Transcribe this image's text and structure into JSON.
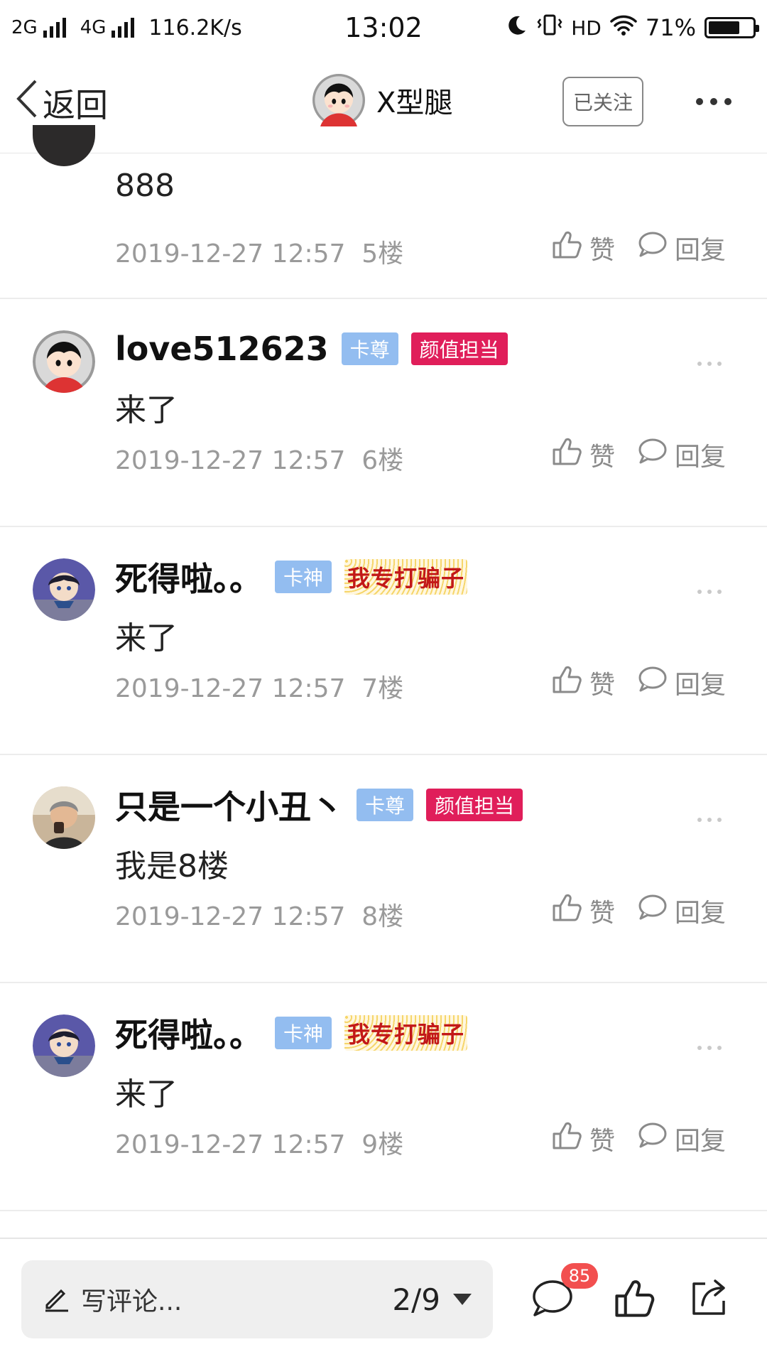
{
  "status_bar": {
    "net1": "2G",
    "net2": "4G",
    "speed": "116.2K/s",
    "time": "13:02",
    "hd": "HD",
    "battery": "71%",
    "battery_level": 0.71
  },
  "nav": {
    "back_label": "返回",
    "title": "X型腿",
    "follow_label": "已关注"
  },
  "partial_comment": {
    "content": "888",
    "time": "2019-12-27 12:57",
    "floor": "5楼",
    "like_label": "赞",
    "reply_label": "回复"
  },
  "comments": [
    {
      "username": "love512623",
      "tags": [
        "卡尊",
        "颜值担当"
      ],
      "content": "来了",
      "time": "2019-12-27 12:57",
      "floor": "6楼",
      "like_label": "赞",
      "reply_label": "回复",
      "avatar": "cartoon-boy"
    },
    {
      "username": "死得啦。。",
      "tags": [
        "卡神",
        "我专打骗子"
      ],
      "content": "来了",
      "time": "2019-12-27 12:57",
      "floor": "7楼",
      "like_label": "赞",
      "reply_label": "回复",
      "avatar": "anime-boy"
    },
    {
      "username": "只是一个小丑丶",
      "tags": [
        "卡尊",
        "颜值担当"
      ],
      "content": "我是8楼",
      "time": "2019-12-27 12:57",
      "floor": "8楼",
      "like_label": "赞",
      "reply_label": "回复",
      "avatar": "photo"
    },
    {
      "username": "死得啦。。",
      "tags": [
        "卡神",
        "我专打骗子"
      ],
      "content": "来了",
      "time": "2019-12-27 12:57",
      "floor": "9楼",
      "like_label": "赞",
      "reply_label": "回复",
      "avatar": "anime-boy"
    }
  ],
  "bottom_bar": {
    "placeholder": "写评论...",
    "page": "2/9",
    "comment_count": "85"
  },
  "colors": {
    "tag_blue": "#93bdf0",
    "tag_red": "#e01e5a",
    "badge": "#f24f4f",
    "meta_text": "#9a9a9a"
  }
}
